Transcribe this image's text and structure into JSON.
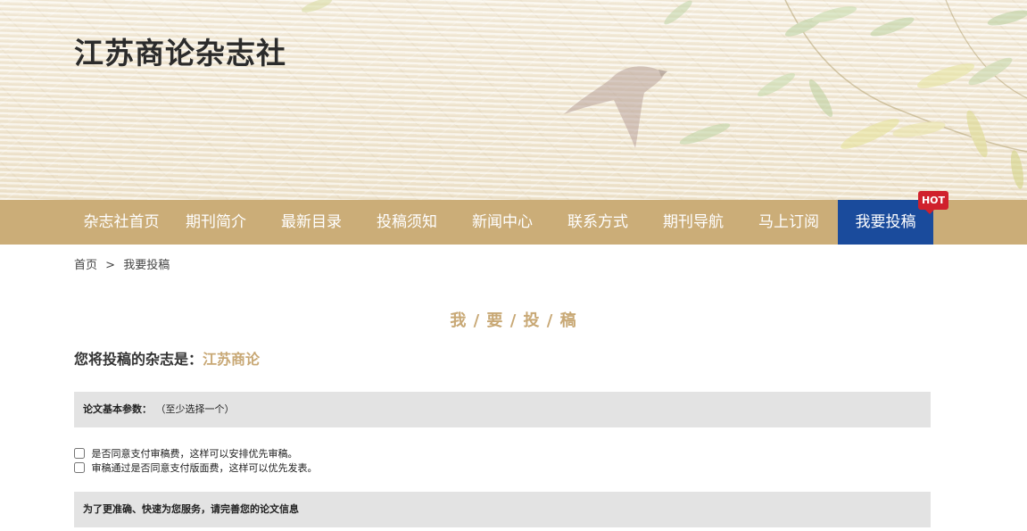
{
  "header": {
    "site_title": "江苏商论杂志社"
  },
  "nav": {
    "items": [
      {
        "label": "杂志社首页"
      },
      {
        "label": "期刊简介"
      },
      {
        "label": "最新目录"
      },
      {
        "label": "投稿须知"
      },
      {
        "label": "新闻中心"
      },
      {
        "label": "联系方式"
      },
      {
        "label": "期刊导航"
      },
      {
        "label": "马上订阅"
      },
      {
        "label": "我要投稿"
      }
    ],
    "hot_badge": "HOT",
    "bar_color": "#cbad78",
    "active_color": "#1a4b9c"
  },
  "breadcrumb": {
    "home": "首页",
    "separator": ">",
    "current": "我要投稿"
  },
  "main": {
    "heading": "我 / 要 / 投 / 稿",
    "target_prefix": "您将投稿的杂志是：",
    "target_journal": "江苏商论",
    "accent_color": "#c8a875",
    "params_section": {
      "title": "论文基本参数：",
      "hint": "（至少选择一个）"
    },
    "options": [
      {
        "label": "是否同意支付审稿费，这样可以安排优先审稿。",
        "checked": false
      },
      {
        "label": "审稿通过是否同意支付版面费，这样可以优先发表。",
        "checked": false
      }
    ],
    "info_section": {
      "title": "为了更准确、快速为您服务，请完善您的论文信息"
    }
  }
}
